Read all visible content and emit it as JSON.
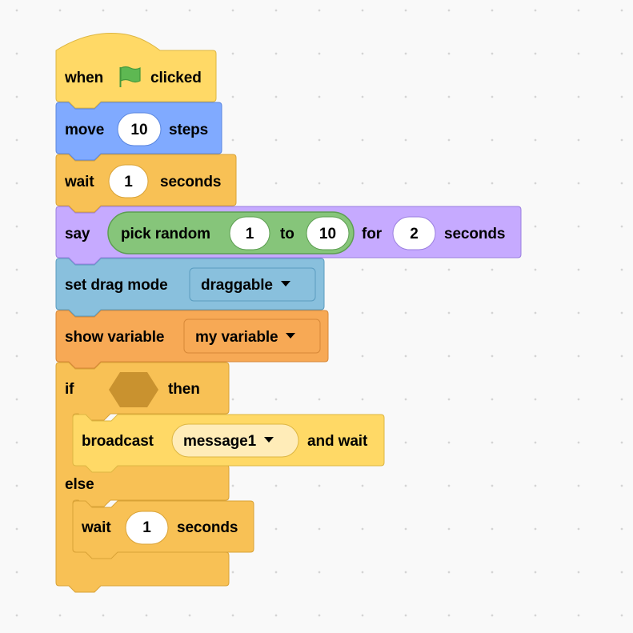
{
  "colors": {
    "events": "#ffd966",
    "events_border": "#ddb642",
    "motion": "#80aaff",
    "motion_border": "#5a86df",
    "control": "#f8c155",
    "control_border": "#d9a236",
    "looks": "#c6aaff",
    "looks_border": "#9a7fdf",
    "operators": "#86c57a",
    "operators_border": "#5c9e51",
    "sensing": "#89c0dd",
    "sensing_border": "#5a9cc0",
    "variables": "#f7a955",
    "variables_border": "#d78838",
    "boolean_slot": "#c9922f",
    "flag": "#5eb852",
    "broadcast_menu": "#ffecb8"
  },
  "script": {
    "hat": {
      "label_when": "when",
      "icon": "green-flag-icon",
      "label_clicked": "clicked"
    },
    "move": {
      "label_move": "move",
      "steps_value": "10",
      "label_steps": "steps"
    },
    "wait1": {
      "label_wait": "wait",
      "value": "1",
      "label_seconds": "seconds"
    },
    "say": {
      "label_say": "say",
      "pick_random": {
        "label": "pick random",
        "from": "1",
        "label_to": "to",
        "to": "10"
      },
      "label_for": "for",
      "secs_value": "2",
      "label_seconds": "seconds"
    },
    "drag": {
      "label": "set drag mode",
      "option": "draggable"
    },
    "show_var": {
      "label": "show variable",
      "option": "my variable"
    },
    "if_else": {
      "label_if": "if",
      "label_then": "then",
      "label_else": "else",
      "broadcast": {
        "label": "broadcast",
        "message": "message1",
        "label_and_wait": "and wait"
      },
      "wait2": {
        "label_wait": "wait",
        "value": "1",
        "label_seconds": "seconds"
      }
    }
  }
}
